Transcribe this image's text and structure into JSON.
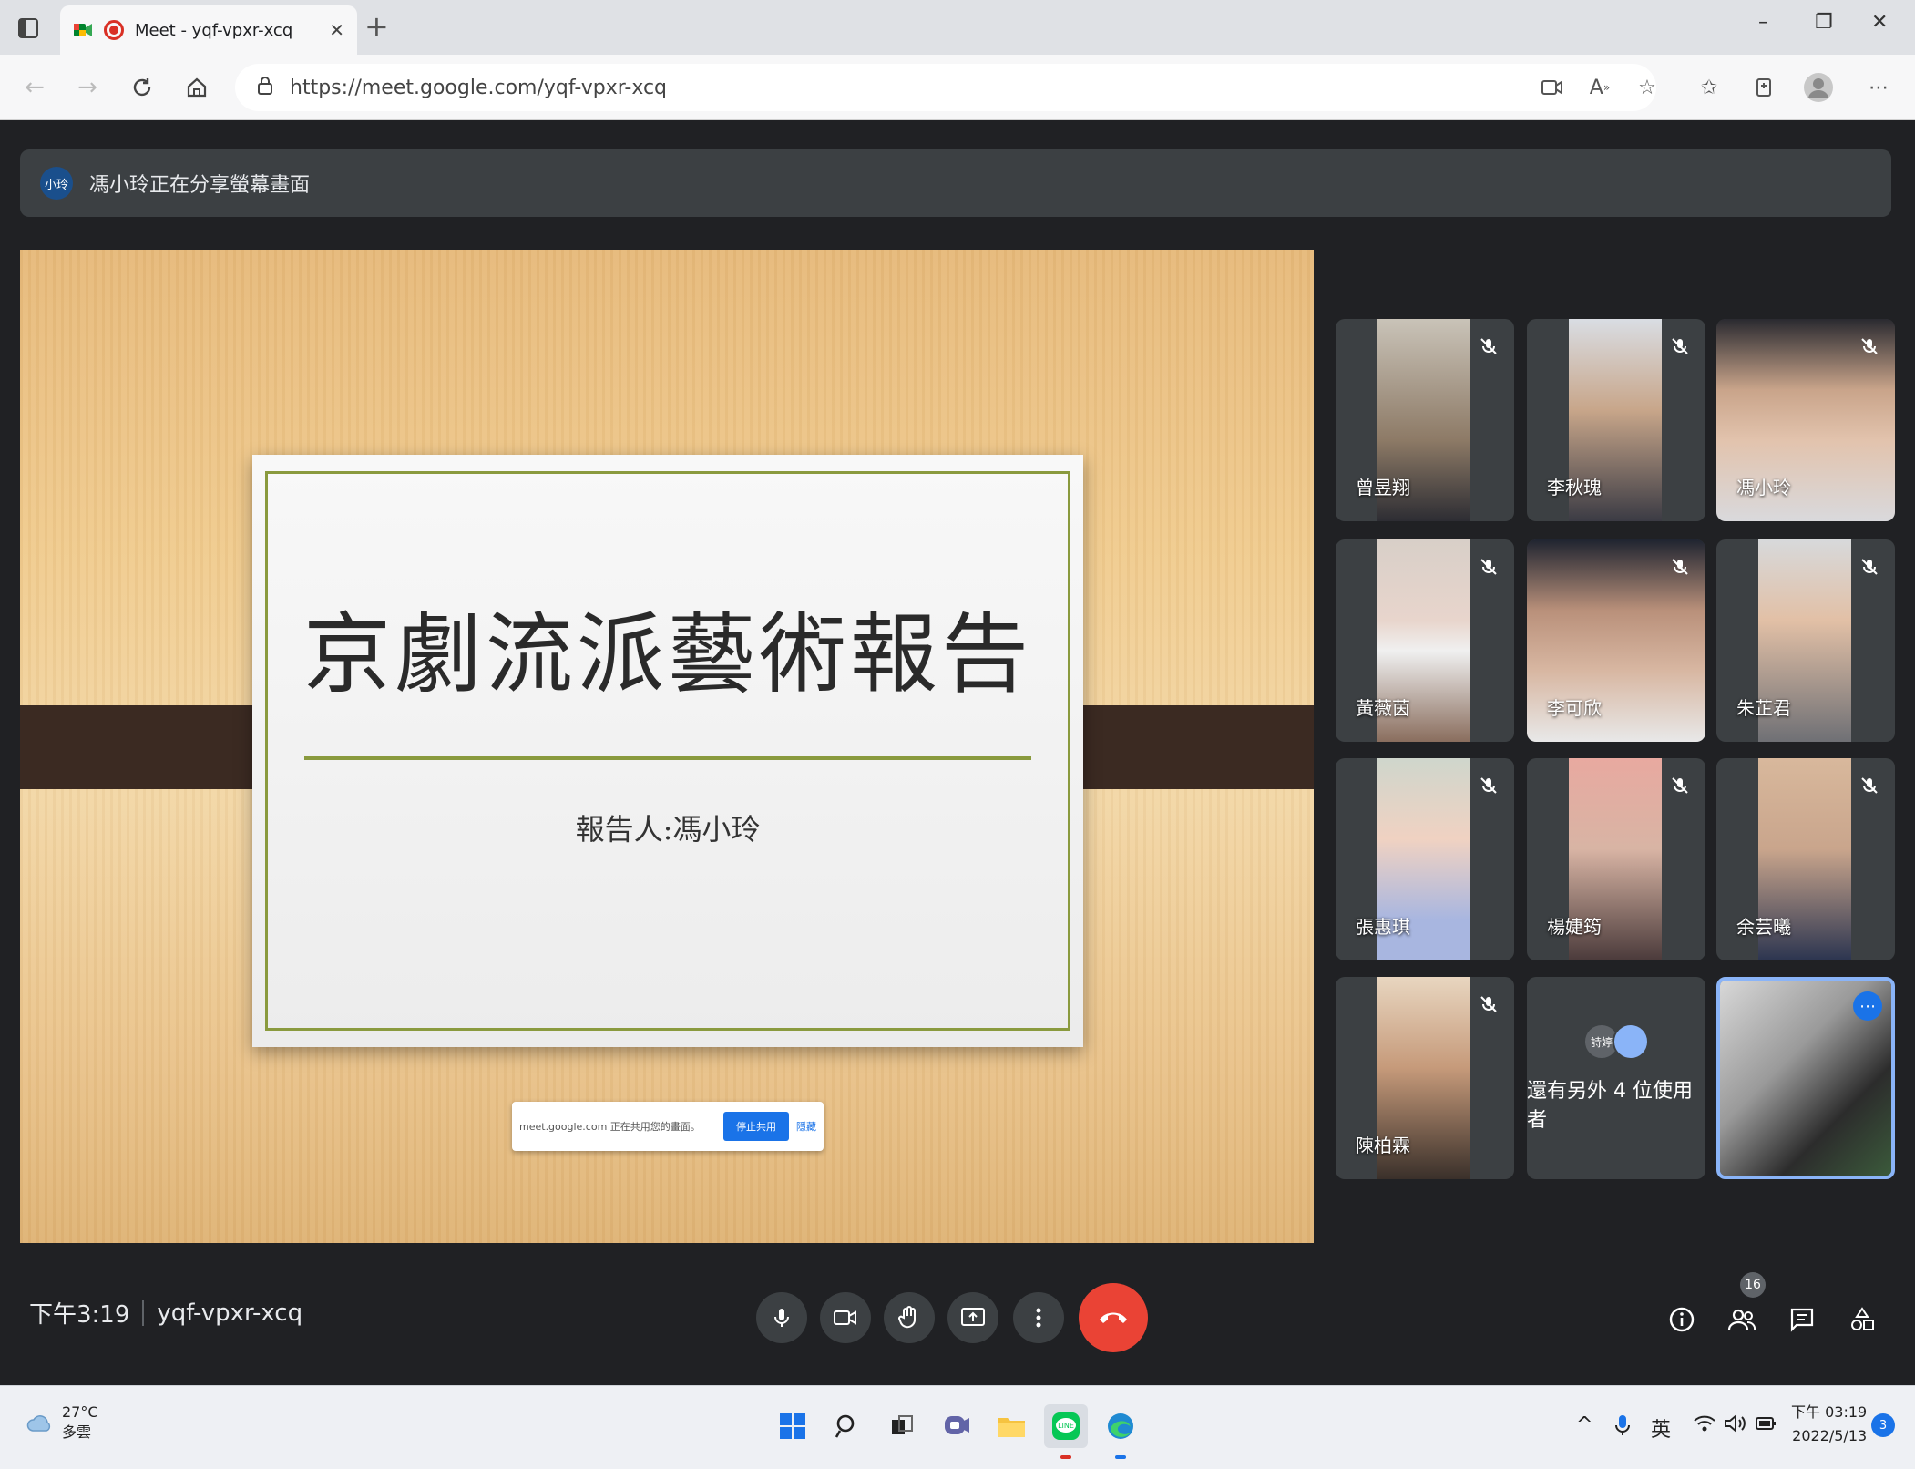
{
  "browser": {
    "tab_title": "Meet - yqf-vpxr-xcq",
    "new_tab_symbol": "+",
    "url": "https://meet.google.com/yqf-vpxr-xcq",
    "window_controls": {
      "minimize": "–",
      "restore": "❐",
      "close": "✕"
    }
  },
  "meet": {
    "share_banner": {
      "avatar_text": "小玲",
      "text": "馮小玲正在分享螢幕畫面"
    },
    "presentation": {
      "slide_title": "京劇流派藝術報告",
      "slide_subtitle": "報告人:馮小玲",
      "share_notice": {
        "message": "meet.google.com 正在共用您的畫面。",
        "stop_label": "停止共用",
        "hide_label": "隱藏"
      }
    },
    "participants": [
      {
        "name": "曾昱翔",
        "muted": true
      },
      {
        "name": "李秋瑰",
        "muted": true
      },
      {
        "name": "馮小玲",
        "muted": true
      },
      {
        "name": "黃薇茵",
        "muted": true
      },
      {
        "name": "李可欣",
        "muted": true
      },
      {
        "name": "朱芷君",
        "muted": true
      },
      {
        "name": "張惠琪",
        "muted": true
      },
      {
        "name": "楊婕筠",
        "muted": true
      },
      {
        "name": "余芸曦",
        "muted": true
      },
      {
        "name": "陳柏霖",
        "muted": true
      }
    ],
    "others_tile": {
      "avatar_text": "詩婷",
      "label": "還有另外 4 位使用者"
    },
    "meeting_info": {
      "time": "下午3:19",
      "code": "yqf-vpxr-xcq"
    },
    "people_count": "16"
  },
  "taskbar": {
    "weather": {
      "temp": "27°C",
      "desc": "多雲"
    },
    "ime": "英",
    "clock": {
      "time": "下午 03:19",
      "date": "2022/5/13"
    },
    "notification_count": "3"
  },
  "colors": {
    "meet_bg": "#202124",
    "tile_bg": "#3c4043",
    "end_call": "#ea4335",
    "accent": "#1a73e8",
    "slide_green": "#8a9a3e"
  }
}
